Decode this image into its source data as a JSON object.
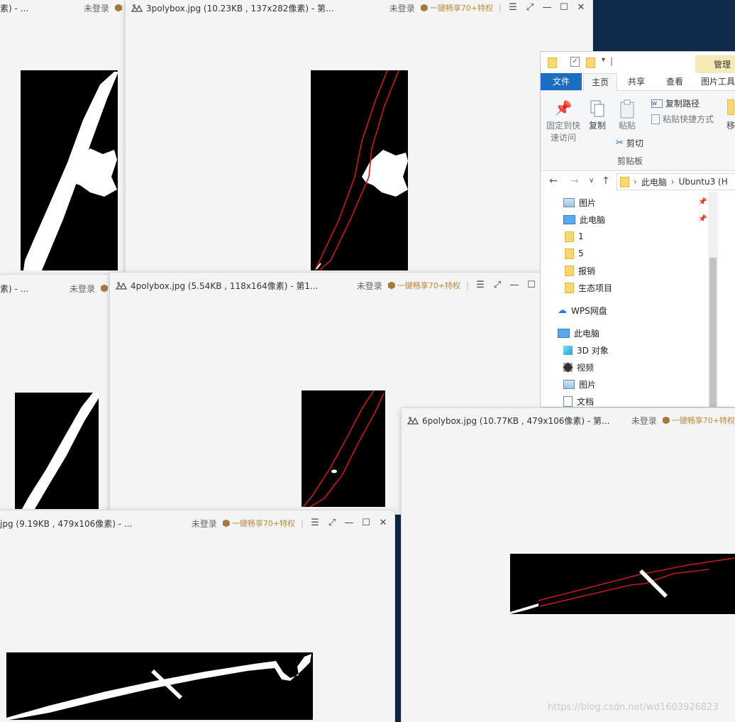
{
  "status": {
    "login": "未登录",
    "vip": "一键畅享70+特权"
  },
  "windows": [
    {
      "id": "w1",
      "title": "素) - ..."
    },
    {
      "id": "w3",
      "title": "3polybox.jpg (10.23KB , 137x282像素) - 第..."
    },
    {
      "id": "w2",
      "title": "素) - ..."
    },
    {
      "id": "w4",
      "title": "4polybox.jpg (5.54KB , 118x164像素) - 第1..."
    },
    {
      "id": "w5",
      "title": "jpg (9.19KB , 479x106像素) - ..."
    },
    {
      "id": "w6",
      "title": "6polybox.jpg (10.77KB , 479x106像素) - 第..."
    }
  ],
  "explorer": {
    "manage": "管理",
    "tabs": [
      "文件",
      "主页",
      "共享",
      "查看",
      "图片工具"
    ],
    "ribbon": {
      "pin": "固定到快速访问",
      "pin_l1": "固定到快",
      "pin_l2": "速访问",
      "copy": "复制",
      "paste": "粘贴",
      "copy_path": "复制路径",
      "paste_shortcut": "粘贴快捷方式",
      "cut": "剪切",
      "clipboard": "剪贴板",
      "move": "移"
    },
    "address": [
      "此电脑",
      "Ubuntu3 (H"
    ],
    "tree": [
      {
        "label": "图片",
        "icon": "pictures-icon",
        "pinned": true
      },
      {
        "label": "此电脑",
        "icon": "computer-icon",
        "pinned": true
      },
      {
        "label": "1",
        "icon": "folder-icon",
        "pinned": false
      },
      {
        "label": "5",
        "icon": "folder-icon",
        "pinned": false
      },
      {
        "label": "报销",
        "icon": "folder-icon",
        "pinned": false
      },
      {
        "label": "生态项目",
        "icon": "folder-icon",
        "pinned": false
      },
      {
        "label": "WPS网盘",
        "icon": "cloud-icon",
        "pinned": false
      },
      {
        "label": "此电脑",
        "icon": "computer-icon",
        "pinned": false
      },
      {
        "label": "3D 对象",
        "icon": "cube-icon",
        "pinned": false
      },
      {
        "label": "视频",
        "icon": "video-icon",
        "pinned": false
      },
      {
        "label": "图片",
        "icon": "pictures-icon",
        "pinned": false
      },
      {
        "label": "文档",
        "icon": "document-icon",
        "pinned": false
      }
    ]
  },
  "watermark": "https://blog.csdn.net/wd1603926823"
}
